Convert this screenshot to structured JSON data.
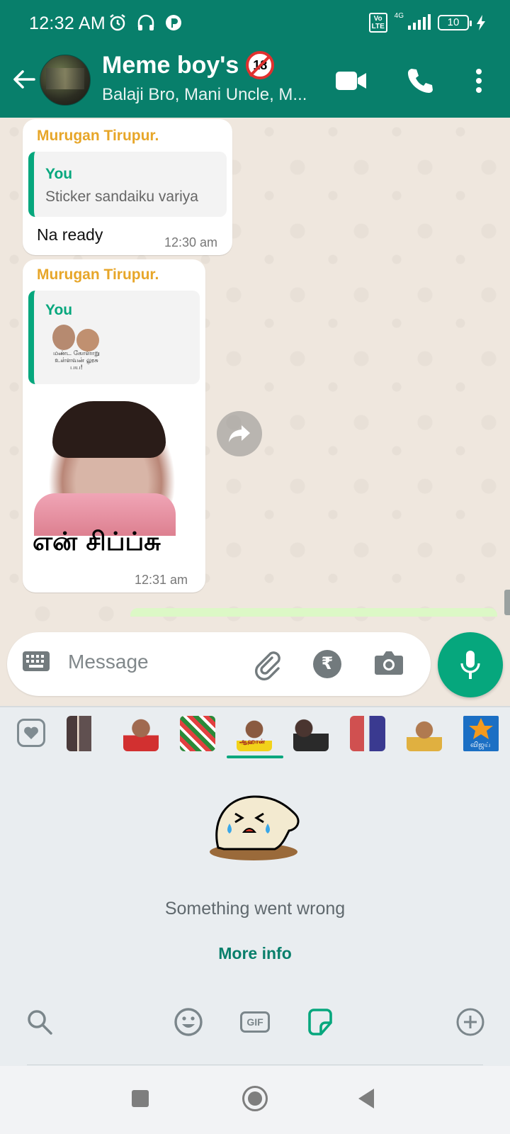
{
  "status_bar": {
    "time": "12:32 AM",
    "network": "4G",
    "volte": "Vo LTE",
    "battery": "10"
  },
  "header": {
    "title": "Meme boy's",
    "subtitle": "Balaji Bro, Mani Uncle, M...",
    "age_badge": "18",
    "icons": [
      "back-arrow-icon",
      "video-call-icon",
      "voice-call-icon",
      "more-options-icon"
    ]
  },
  "messages": [
    {
      "sender": "Murugan Tirupur.",
      "quote_author": "You",
      "quote_text": "Sticker sandaiku variya",
      "text": "Na ready",
      "time": "12:30 am"
    },
    {
      "sender": "Murugan Tirupur.",
      "quote_author": "You",
      "quote_sticker_text": "மண்ட கோளாறு உள்ளவன் லூசு பய!",
      "sticker_caption": "என் சிப்ப்சு",
      "time": "12:31 am"
    }
  ],
  "input": {
    "placeholder": "Message",
    "payment_symbol": "₹"
  },
  "sticker_tray": {
    "error_message": "Something went wrong",
    "more_info": "More info",
    "pack_labels": [
      "ஆஹான்",
      "விஜய்"
    ],
    "bottom_tabs": {
      "gif_label": "GIF"
    }
  },
  "colors": {
    "primary": "#087f6b",
    "accent": "#06a77d",
    "sender_name": "#e7a629",
    "chat_bg": "#efe7de"
  }
}
